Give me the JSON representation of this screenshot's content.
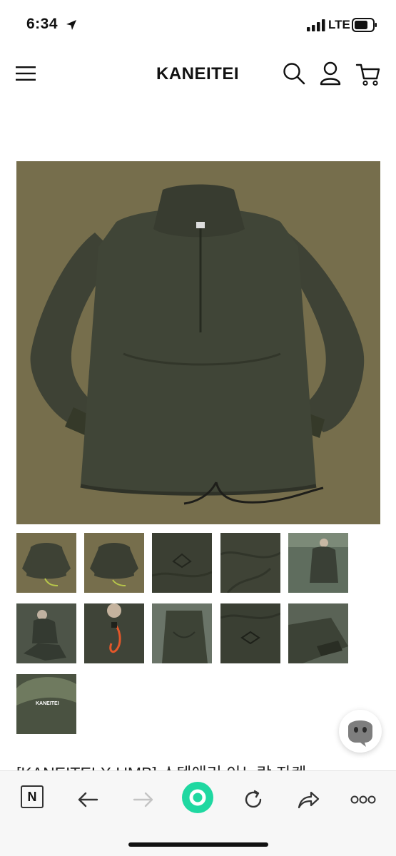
{
  "status_bar": {
    "time": "6:34",
    "network": "LTE",
    "icons": [
      "location-arrow-icon",
      "signal-icon",
      "battery-icon"
    ]
  },
  "header": {
    "brand": "KANEITEI",
    "icons": [
      "menu-icon",
      "search-icon",
      "account-icon",
      "cart-icon"
    ]
  },
  "product": {
    "main_image": "olive green half-zip anorak jacket with drawstring hem",
    "thumbnails": [
      "front view",
      "back view",
      "chest logo detail",
      "fabric detail",
      "model wearing jacket",
      "model seated",
      "orange drawcord detail",
      "sleeve detail",
      "embroidered logo detail",
      "cuff detail",
      "KANEITEI label detail"
    ],
    "thumb_logo_text": "KANEITEI",
    "title": "[KANEITEI X UMB] 스텐애리 아노락 자켓"
  },
  "chat": {
    "icon": "chat-bot-icon"
  },
  "browser_bar": {
    "n_label": "N",
    "icons": [
      "back-arrow-icon",
      "forward-arrow-icon",
      "home-icon",
      "reload-icon",
      "share-icon",
      "more-icon"
    ]
  },
  "colors": {
    "accent": "#1fd8a1",
    "background": "#ffffff",
    "image_bg": "#766e4c",
    "jacket": "#3e4235"
  }
}
